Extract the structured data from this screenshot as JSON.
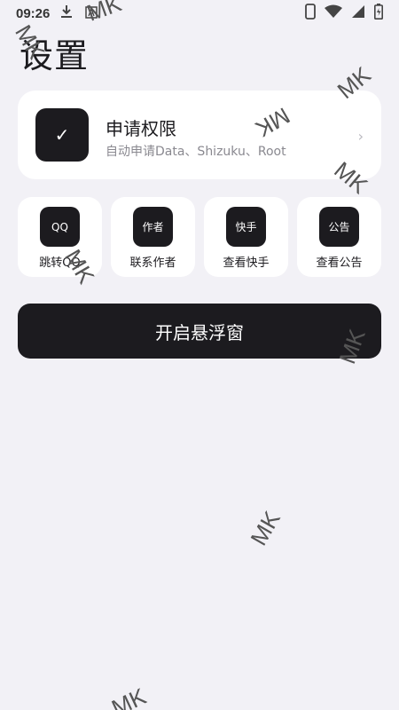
{
  "status_bar": {
    "time": "09:26",
    "icons": [
      "download-icon",
      "font-a-icon",
      "phone-icon",
      "wifi-icon",
      "signal-icon",
      "battery-icon"
    ]
  },
  "page_title": "设置",
  "permission_card": {
    "icon_glyph": "✓",
    "title": "申请权限",
    "subtitle": "自动申请Data、Shizuku、Root",
    "chevron": "›"
  },
  "quick_actions": [
    {
      "icon_text": "QQ",
      "label": "跳转QQ"
    },
    {
      "icon_text": "作者",
      "label": "联系作者"
    },
    {
      "icon_text": "快手",
      "label": "查看快手"
    },
    {
      "icon_text": "公告",
      "label": "查看公告"
    }
  ],
  "float_button": {
    "label": "开启悬浮窗"
  },
  "watermark": {
    "text": "MK"
  },
  "colors": {
    "background": "#f2f1f6",
    "card": "#ffffff",
    "dark": "#1c1b1f",
    "subtitle": "#8a8990"
  }
}
